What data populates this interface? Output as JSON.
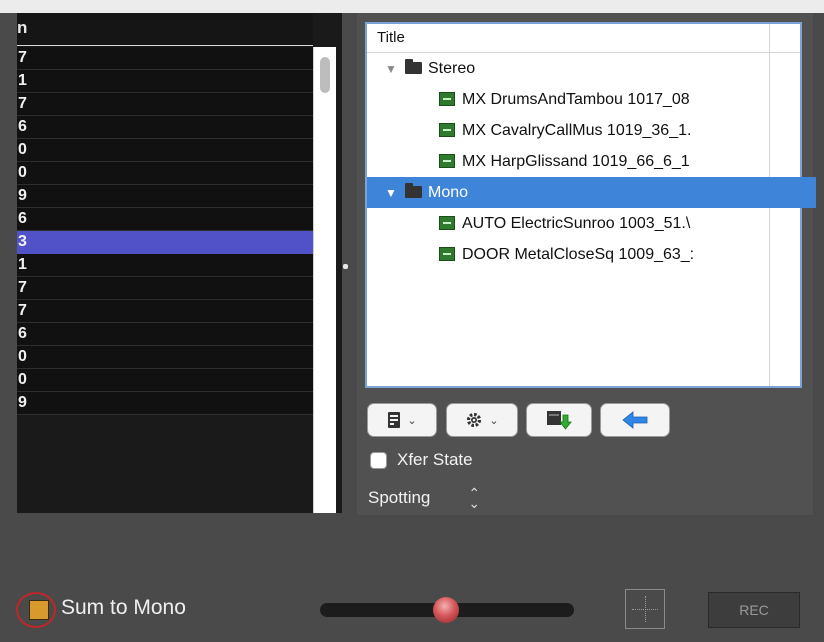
{
  "left_list": {
    "header": "n",
    "rows": [
      "7",
      "1",
      "7",
      "6",
      "0",
      "0",
      "9",
      "6",
      "3",
      "1",
      "7",
      "7",
      "6",
      "0",
      "0",
      "9"
    ],
    "selected_index": 8
  },
  "tree": {
    "column_title": "Title",
    "items": [
      {
        "label": "Stereo",
        "kind": "folder",
        "level": 1,
        "expanded": true,
        "selected": false
      },
      {
        "label": "MX DrumsAndTambou 1017_08",
        "kind": "audio",
        "level": 2,
        "selected": false
      },
      {
        "label": "MX CavalryCallMus 1019_36_1.",
        "kind": "audio",
        "level": 2,
        "selected": false
      },
      {
        "label": "MX HarpGlissand 1019_66_6_1",
        "kind": "audio",
        "level": 2,
        "selected": false
      },
      {
        "label": "Mono",
        "kind": "folder",
        "level": 1,
        "expanded": true,
        "selected": true
      },
      {
        "label": "AUTO ElectricSunroo 1003_51.\\",
        "kind": "audio",
        "level": 2,
        "selected": false
      },
      {
        "label": "DOOR MetalCloseSq 1009_63_:",
        "kind": "audio",
        "level": 2,
        "selected": false
      }
    ]
  },
  "toolbar": {
    "buttons": [
      {
        "name": "list-menu",
        "icon": "list-icon",
        "has_menu": true
      },
      {
        "name": "actions-menu",
        "icon": "gear-icon",
        "has_menu": true
      },
      {
        "name": "import",
        "icon": "import-icon",
        "has_menu": false
      },
      {
        "name": "back",
        "icon": "arrow-left-icon",
        "has_menu": false
      }
    ]
  },
  "xfer_state": {
    "label": "Xfer State",
    "checked": false
  },
  "spotting": {
    "label": "Spotting"
  },
  "bottom": {
    "sum_to_mono_label": "Sum to Mono",
    "sum_to_mono_checked": true,
    "rec_label": "REC"
  },
  "colors": {
    "selection_blue": "#3e84d8",
    "left_selection": "#5252c8",
    "slider_knob": "#d4575a",
    "sum_checkbox": "#d89a2c",
    "highlight_circle": "#c0262a"
  }
}
